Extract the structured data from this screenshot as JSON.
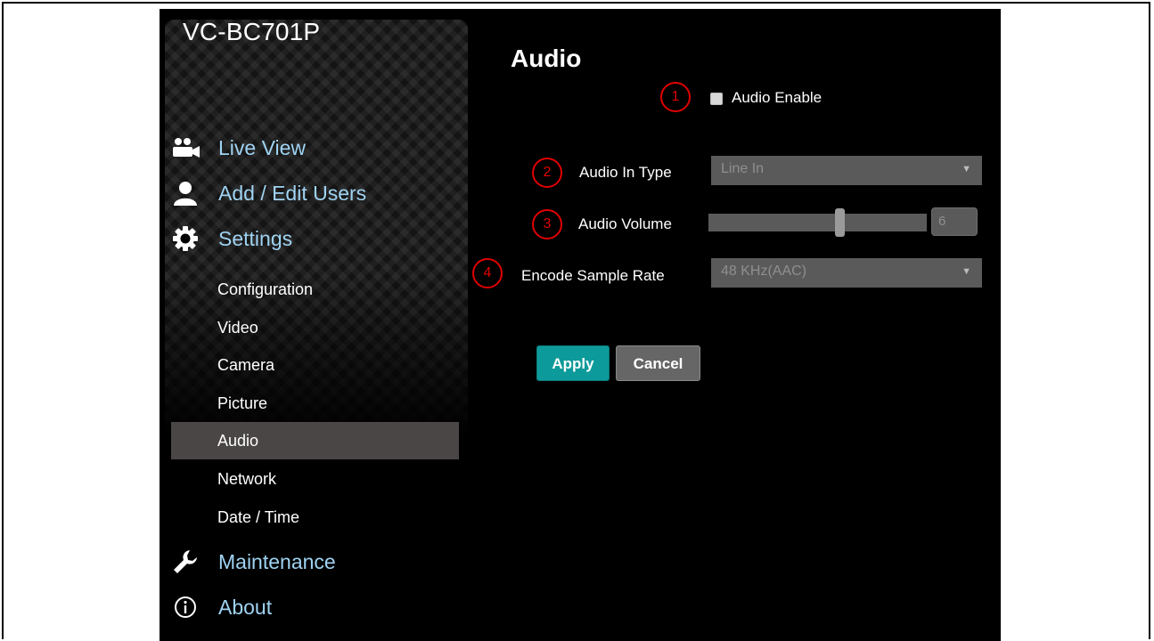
{
  "sidebar": {
    "model": "VC-BC701P",
    "main_items": [
      {
        "label": "Live View",
        "icon": "camera-users-icon"
      },
      {
        "label": "Add / Edit Users",
        "icon": "user-icon"
      },
      {
        "label": "Settings",
        "icon": "gear-icon"
      },
      {
        "label": "Maintenance",
        "icon": "wrench-icon"
      },
      {
        "label": "About",
        "icon": "info-icon"
      }
    ],
    "sub_items": [
      {
        "label": "Configuration"
      },
      {
        "label": "Video"
      },
      {
        "label": "Camera"
      },
      {
        "label": "Picture"
      },
      {
        "label": "Audio",
        "active": true
      },
      {
        "label": "Network"
      },
      {
        "label": "Date / Time"
      }
    ]
  },
  "page": {
    "title": "Audio",
    "markers": [
      "1",
      "2",
      "3",
      "4"
    ],
    "audio_enable": {
      "label": "Audio Enable",
      "checked": false
    },
    "audio_in_type": {
      "label": "Audio In Type",
      "value": "Line In"
    },
    "audio_volume": {
      "label": "Audio Volume",
      "value": "6",
      "level_fraction": 0.6
    },
    "sample_rate": {
      "label": "Encode Sample Rate",
      "value": "48 KHz(AAC)"
    },
    "buttons": {
      "apply": "Apply",
      "cancel": "Cancel"
    }
  },
  "colors": {
    "accent_link": "#9fd3f2",
    "apply_button": "#0d9a9a",
    "active_item_bg": "#4a4646",
    "annotation_red": "#e00000"
  }
}
